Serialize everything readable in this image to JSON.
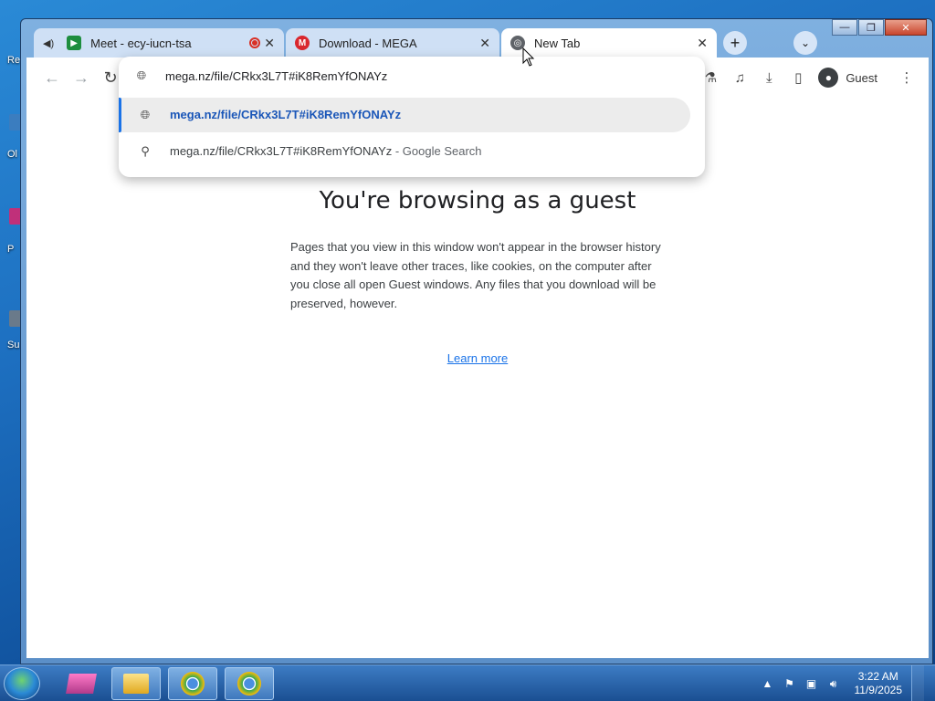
{
  "desktop": {
    "labels": [
      "Re",
      "Ol",
      "P",
      "Su"
    ]
  },
  "window": {
    "controls": {
      "minimize": "—",
      "maximize": "❐",
      "close": "✕"
    }
  },
  "tabs": [
    {
      "title": "Meet - ecy-iucn-tsa",
      "icon": "meet-icon",
      "audio": true,
      "recording": true
    },
    {
      "title": "Download - MEGA",
      "icon": "mega-icon"
    },
    {
      "title": "New Tab",
      "icon": "globe-icon",
      "active": true
    }
  ],
  "toolbar": {
    "profile_label": "Guest"
  },
  "omnibox": {
    "input_value": "mega.nz/file/CRkx3L7T#iK8RemYfONAYz",
    "suggestions": [
      {
        "icon": "globe-icon",
        "text": "mega.nz/file/CRkx3L7T#iK8RemYfONAYz",
        "selected": true
      },
      {
        "icon": "search-icon",
        "text": "mega.nz/file/CRkx3L7T#iK8RemYfONAYz",
        "suffix": " - Google Search"
      }
    ]
  },
  "page": {
    "title": "You're browsing as a guest",
    "body": "Pages that you view in this window won't appear in the browser history and they won't leave other traces, like cookies, on the computer after you close all open Guest windows. Any files that you download will be preserved, however.",
    "learn_more": "Learn more"
  },
  "taskbar": {
    "clock_time": "3:22 AM",
    "clock_date": "11/9/2025"
  }
}
